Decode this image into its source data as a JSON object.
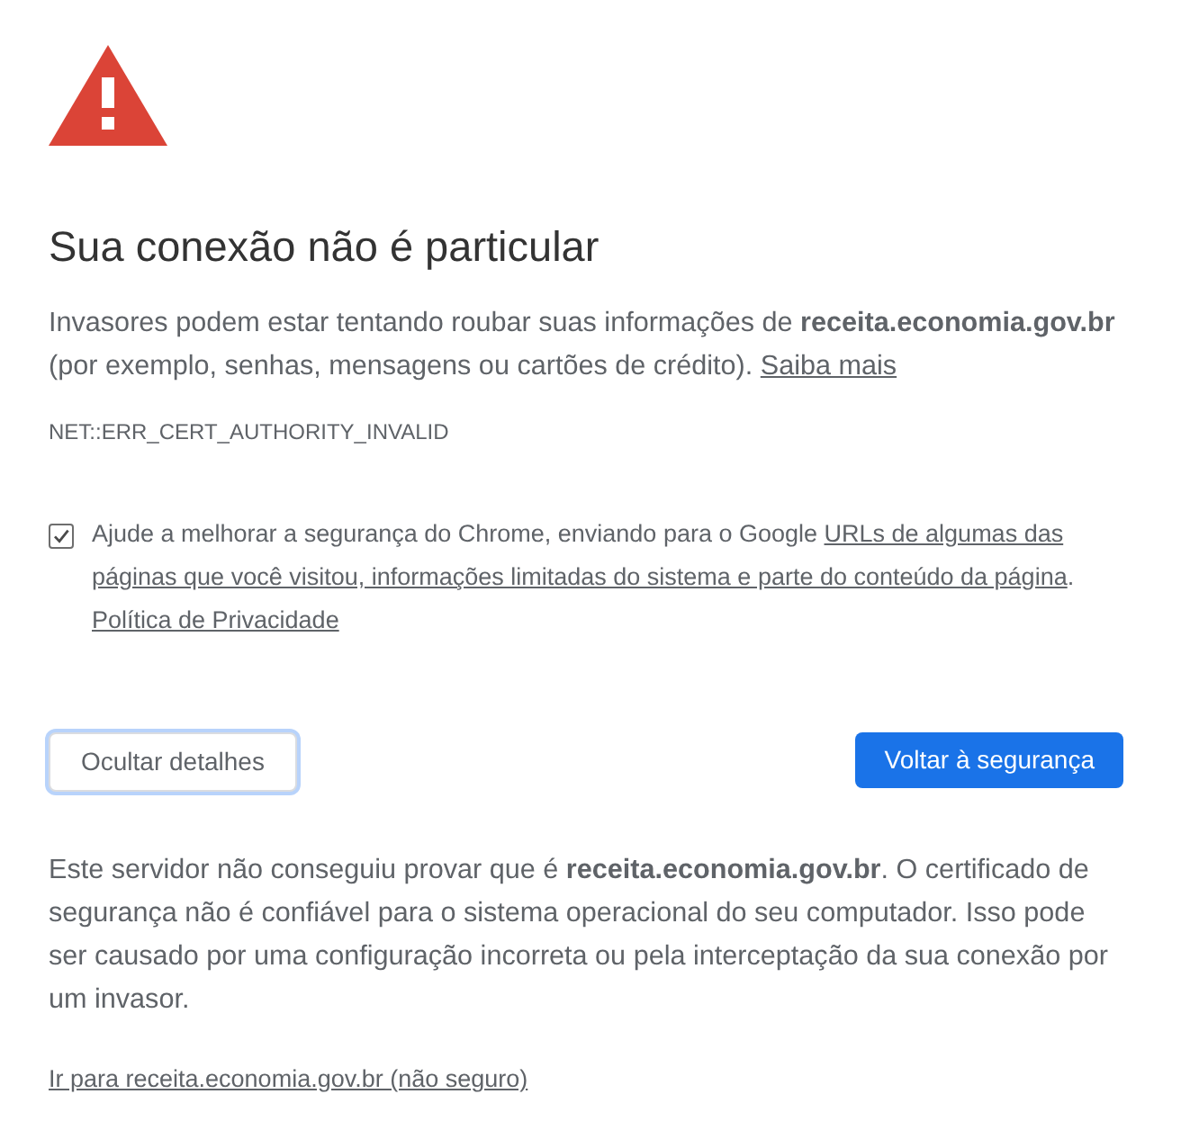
{
  "title": "Sua conexão não é particular",
  "message": {
    "text": "Invasores podem estar tentando roubar suas informações de **receita.economia.gov.br** (por exemplo, senhas, mensagens ou cartões de crédito).",
    "link": "Saiba mais"
  },
  "error_code": "NET::ERR_CERT_AUTHORITY_INVALID",
  "report_option": {
    "checked": true,
    "text": "Ajude a melhorar a segurança do Chrome, enviando para o Google",
    "link_lines": [
      "URLs de algumas das",
      "páginas que você visitou, informações limitadas do sistema e parte do conteúdo da página"
    ],
    "after_link": ".",
    "privacy_link": "Política de Privacidade"
  },
  "buttons": [
    {
      "label": "Ocultar detalhes",
      "kind": "secondary",
      "focused": true
    },
    {
      "label": "Voltar à segurança",
      "kind": "primary",
      "focused": false
    }
  ],
  "details": {
    "text": "Este servidor não conseguiu provar que é **receita.economia.gov.br**. O certificado de segurança não é confiável para o sistema operacional do seu computador. Isso pode ser causado por uma configuração incorreta ou pela interceptação da sua conexão por um invasor."
  },
  "proceed_link": "Ir para receita.economia.gov.br (não seguro)"
}
